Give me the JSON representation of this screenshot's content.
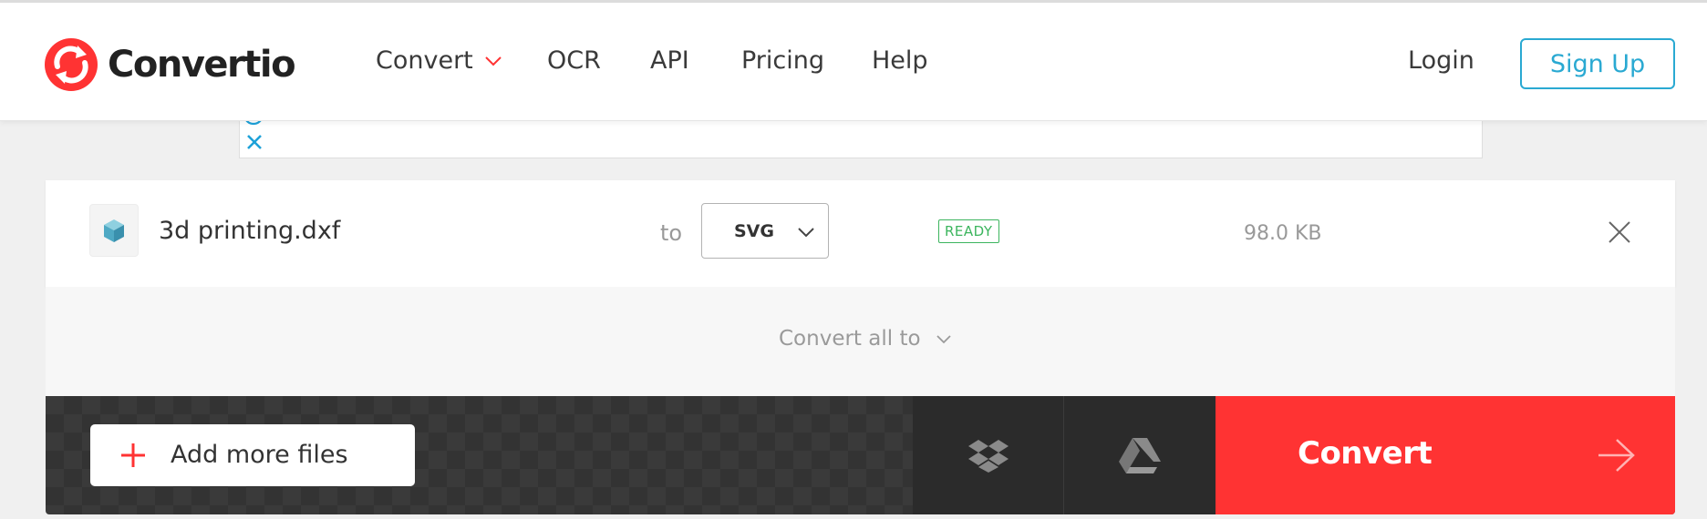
{
  "brand": {
    "name": "Convertio",
    "accent": "#ff3333",
    "link_color": "#2aa9d2"
  },
  "nav": {
    "items": [
      {
        "label": "Convert",
        "has_dropdown": true
      },
      {
        "label": "OCR"
      },
      {
        "label": "API"
      },
      {
        "label": "Pricing"
      },
      {
        "label": "Help"
      }
    ],
    "login_label": "Login",
    "signup_label": "Sign Up"
  },
  "ad": {
    "icons": [
      "adchoices-icon",
      "close-icon"
    ]
  },
  "file": {
    "name": "3d printing.dxf",
    "icon": "cube-icon",
    "to_label": "to",
    "target_format": "SVG",
    "status": "READY",
    "status_color": "#3cb55e",
    "size": "98.0 KB"
  },
  "convert_all": {
    "label": "Convert all to"
  },
  "actions": {
    "add_files_label": "Add more files",
    "cloud_sources": [
      "dropbox-icon",
      "google-drive-icon"
    ],
    "convert_label": "Convert"
  }
}
